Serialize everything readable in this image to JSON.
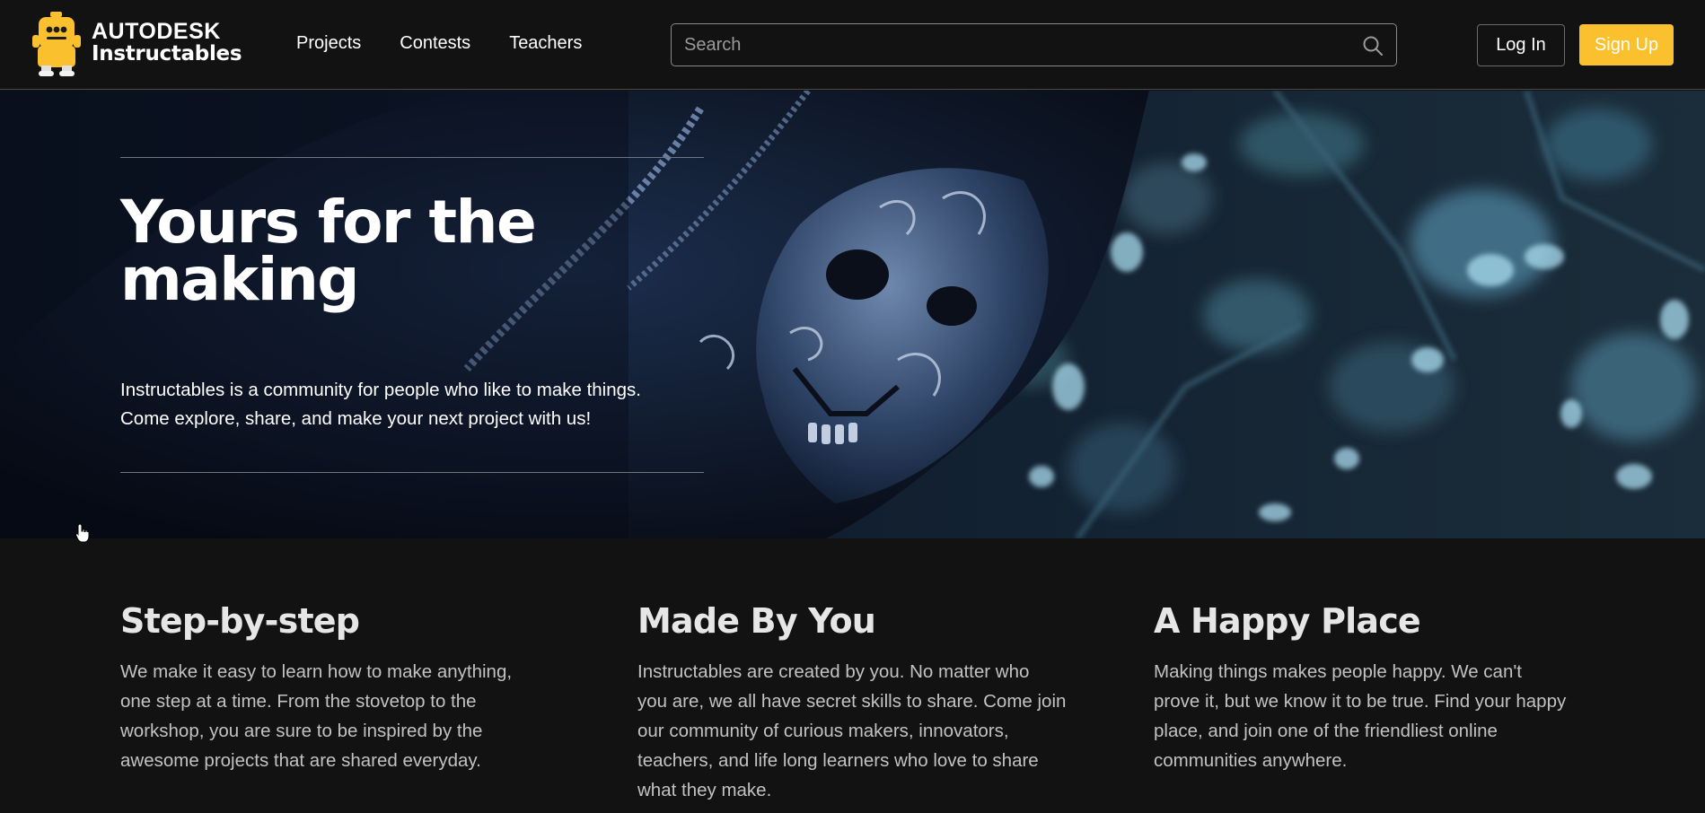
{
  "header": {
    "logo": {
      "brand": "AUTODESK",
      "product": "Instructables"
    },
    "nav": [
      {
        "label": "Projects"
      },
      {
        "label": "Contests"
      },
      {
        "label": "Teachers"
      }
    ],
    "search": {
      "placeholder": "Search",
      "value": "",
      "icon": "search-icon"
    },
    "login_label": "Log In",
    "signup_label": "Sign Up"
  },
  "hero": {
    "title_line1": "Yours for the",
    "title_line2": "making",
    "subtitle_line1": "Instructables is a community for people who like to make things.",
    "subtitle_line2": "Come explore, share, and make your next project with us!"
  },
  "features": [
    {
      "title": "Step-by-step",
      "lines": [
        "We make it easy to learn how to make anything,",
        "one step at a time. From the stovetop to the",
        "workshop, you are sure to be inspired by the",
        "awesome projects that are shared everyday."
      ]
    },
    {
      "title": "Made By You",
      "lines": [
        "Instructables are created by you. No matter who",
        "you are, we all have secret skills to share. Come join",
        "our community of curious makers, innovators,",
        "teachers, and life long learners who love to share",
        "what they make."
      ]
    },
    {
      "title": "A Happy Place",
      "lines": [
        "Making things makes people happy. We can't",
        "prove it, but we know it to be true. Find your happy",
        "place, and join one of the friendliest online",
        "communities anywhere."
      ]
    }
  ],
  "colors": {
    "background": "#121212",
    "accent": "#fbc02d",
    "text": "#ffffff",
    "muted_text": "#c2c2c2"
  }
}
